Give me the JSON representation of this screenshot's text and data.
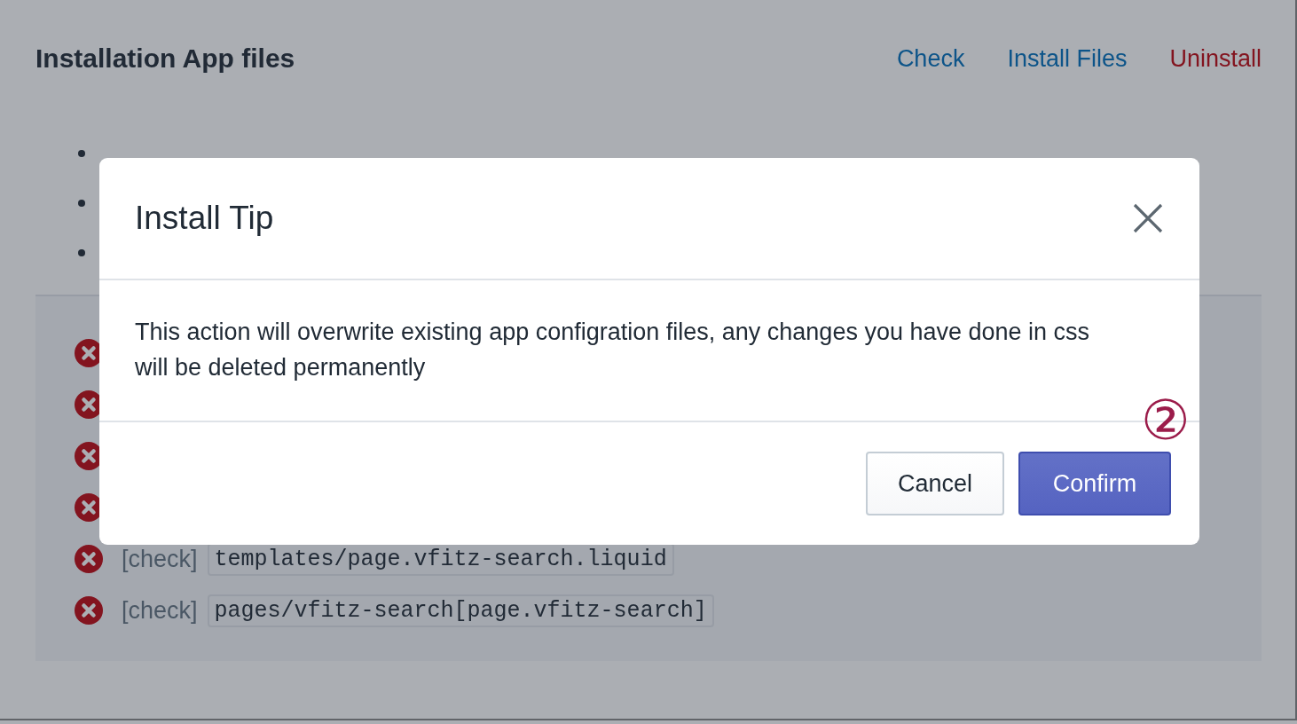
{
  "page": {
    "title": "Installation App files",
    "actions": [
      {
        "label": "Check",
        "kind": "link"
      },
      {
        "label": "Install Files",
        "kind": "link"
      },
      {
        "label": "Uninstall",
        "kind": "danger"
      }
    ],
    "bullets": [
      {
        "kind": "covered"
      },
      {
        "kind": "covered"
      },
      {
        "kind": "covered"
      }
    ],
    "checks": [
      {
        "passed": false
      },
      {
        "passed": false
      },
      {
        "passed": false
      },
      {
        "passed": false
      },
      {
        "passed": false,
        "label": "[check]",
        "path": "templates/page.vfitz-search.liquid"
      },
      {
        "passed": false,
        "label": "[check]",
        "path": "pages/vfitz-search[page.vfitz-search]"
      }
    ]
  },
  "modal": {
    "title": "Install Tip",
    "message": "This action will overwrite existing app configration files, any changes you have done in css will be deleted permanently",
    "buttons": [
      {
        "label": "Cancel",
        "kind": "secondary"
      },
      {
        "label": "Confirm",
        "kind": "primary"
      }
    ],
    "annotation": "②"
  }
}
